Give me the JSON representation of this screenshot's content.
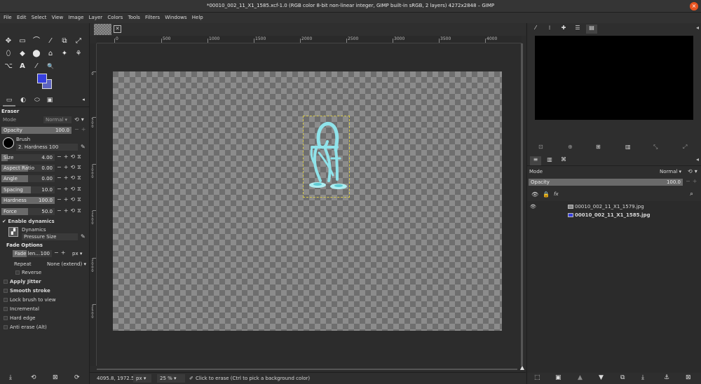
{
  "window": {
    "title": "*00010_002_11_X1_1585.xcf-1.0 (RGB color 8-bit non-linear integer, GIMP built-in sRGB, 2 layers) 4272x2848 – GIMP",
    "close": "×"
  },
  "menu": [
    "File",
    "Edit",
    "Select",
    "View",
    "Image",
    "Layer",
    "Colors",
    "Tools",
    "Filters",
    "Windows",
    "Help"
  ],
  "toolbox": {
    "tools_row1": [
      "✥",
      "▭",
      "⌒",
      "⁄",
      "⧉",
      "⤢"
    ],
    "tools_row2": [
      "⬯",
      "◆",
      "⬤",
      "⌂",
      "✦",
      "⚘"
    ],
    "tools_row3": [
      "⌥",
      "A",
      "⁄",
      "🔍"
    ],
    "colors": {
      "fg": "#3740e0",
      "bg": "#5d64c0"
    }
  },
  "tool_options": {
    "tool_name": "Eraser",
    "mode_label": "Mode",
    "mode_value": "Normal",
    "opacity": {
      "label": "Opacity",
      "value": "100.0",
      "fraction": 1.0
    },
    "brush_label": "Brush",
    "brush_value": "2. Hardness 100",
    "size": {
      "label": "Size",
      "value": "4.00",
      "fraction": 0.12
    },
    "aspect": {
      "label": "Aspect Ratio",
      "value": "0.00",
      "fraction": 0.5
    },
    "angle": {
      "label": "Angle",
      "value": "0.00",
      "fraction": 0.5
    },
    "spacing": {
      "label": "Spacing",
      "value": "10.0",
      "fraction": 0.55
    },
    "hardness": {
      "label": "Hardness",
      "value": "100.0",
      "fraction": 1.0
    },
    "force": {
      "label": "Force",
      "value": "50.0",
      "fraction": 0.5
    },
    "enable_dynamics": "Enable dynamics",
    "dynamics_label": "Dynamics",
    "dynamics_value": "Pressure Size",
    "fade_options": "Fade Options",
    "fade_length_label": "Fade len...",
    "fade_length_value": "100",
    "fade_unit": "px",
    "repeat_label": "Repeat",
    "repeat_value": "None (extend)",
    "reverse": "Reverse",
    "apply_jitter": "Apply Jitter",
    "smooth_stroke": "Smooth stroke",
    "lock_brush": "Lock brush to view",
    "incremental": "Incremental",
    "hard_edge": "Hard edge",
    "anti_erase": "Anti erase  (Alt)"
  },
  "ruler": {
    "h_labels": [
      "0",
      "500",
      "1000",
      "1500",
      "2000",
      "2500",
      "3000",
      "3500",
      "4000"
    ],
    "v_labels": [
      "0",
      "5\n0\n0",
      "1\n0\n0\n0",
      "1\n5\n0\n0",
      "2\n0\n0\n0",
      "2\n5\n0\n0"
    ]
  },
  "status": {
    "coords": "4095.8, 1972.5",
    "unit": "px",
    "zoom": "25 %",
    "message": "Click to erase (Ctrl to pick a background color)"
  },
  "layers_panel": {
    "mode_label": "Mode",
    "mode_value": "Normal",
    "opacity_label": "Opacity",
    "opacity_value": "100.0",
    "layers": [
      {
        "name": "00010_002_11_X1_1579.jpg",
        "visible": true
      },
      {
        "name": "00010_002_11_X1_1585.jpg",
        "visible": false
      }
    ]
  }
}
